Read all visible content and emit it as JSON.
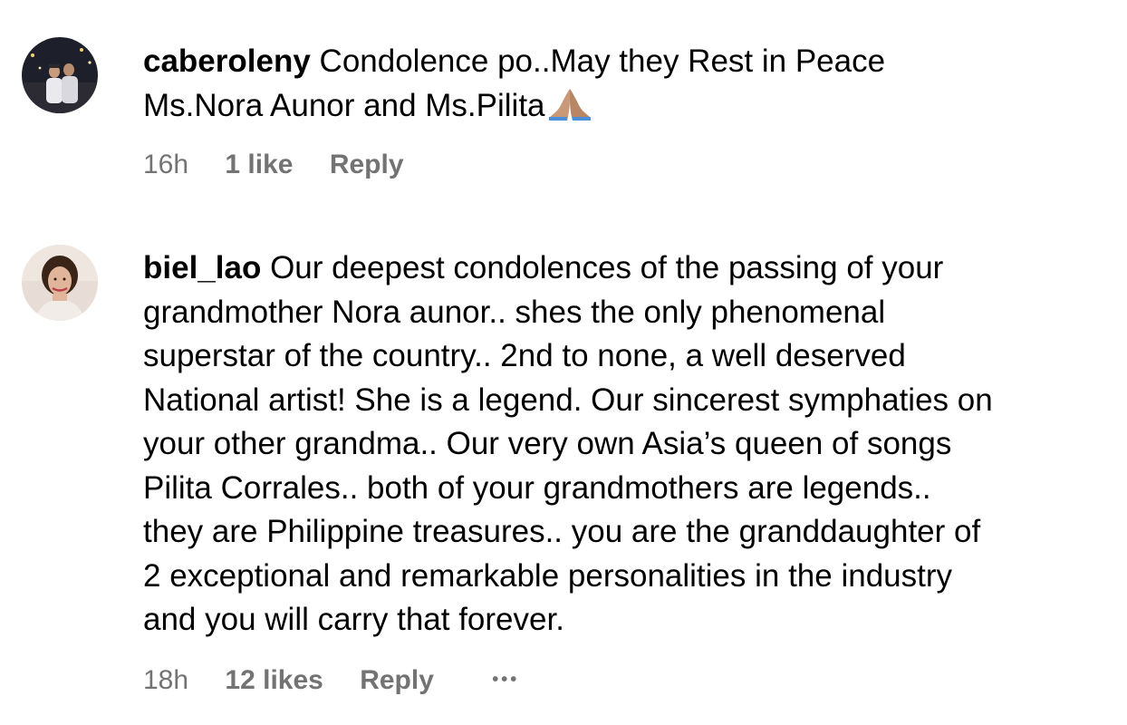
{
  "comments": [
    {
      "username": "caberoleny",
      "text_line1": "Condolence po..May they Rest in Peace",
      "text_line2": "Ms.Nora Aunor and Ms.Pilita",
      "emoji": "folded-hands-icon",
      "time": "16h",
      "likes": "1 like",
      "reply": "Reply"
    },
    {
      "username": "biel_lao",
      "lines": [
        "Our deepest condolences of the passing of your",
        "grandmother Nora aunor.. shes the only phenomenal",
        "superstar of the country.. 2nd to none, a well deserved",
        "National artist! She is a legend. Our sincerest symphaties on",
        "your other grandma.. Our very own Asia’s queen of songs",
        "Pilita Corrales.. both of your grandmothers are legends..",
        "they are Philippine treasures.. you are the granddaughter of",
        "2 exceptional and remarkable personalities in the industry",
        "and you will carry that forever."
      ],
      "time": "18h",
      "likes": "12 likes",
      "reply": "Reply",
      "more": "•••"
    }
  ],
  "colors": {
    "meta_gray": "#737373",
    "text": "#000000",
    "background": "#ffffff"
  }
}
